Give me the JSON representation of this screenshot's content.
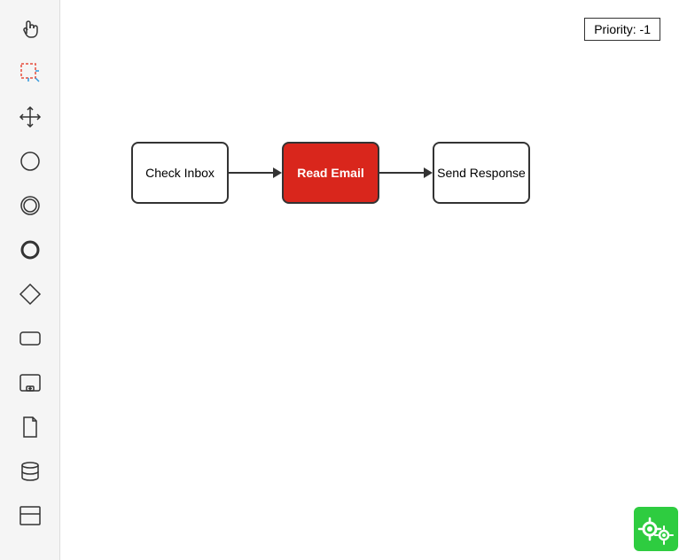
{
  "sidebar": {
    "tools": [
      {
        "name": "hand-tool",
        "label": "Hand"
      },
      {
        "name": "select-tool",
        "label": "Select"
      },
      {
        "name": "move-tool",
        "label": "Move"
      },
      {
        "name": "circle-tool",
        "label": "Circle"
      },
      {
        "name": "ellipse-tool",
        "label": "Ellipse"
      },
      {
        "name": "end-event-tool",
        "label": "End Event"
      },
      {
        "name": "gateway-tool",
        "label": "Gateway"
      },
      {
        "name": "task-tool",
        "label": "Task"
      },
      {
        "name": "subprocess-tool",
        "label": "Subprocess"
      },
      {
        "name": "file-tool",
        "label": "File"
      },
      {
        "name": "db-tool",
        "label": "Database"
      },
      {
        "name": "pool-tool",
        "label": "Pool"
      }
    ]
  },
  "diagram": {
    "nodes": [
      {
        "id": "check-inbox",
        "label": "Check Inbox",
        "type": "normal"
      },
      {
        "id": "read-email",
        "label": "Read Email",
        "type": "red"
      },
      {
        "id": "send-response",
        "label": "Send Response",
        "type": "normal"
      }
    ],
    "arrows": 2
  },
  "priority": {
    "label": "Priority: -1"
  },
  "logo": {
    "alt": "BPMN Logo"
  }
}
